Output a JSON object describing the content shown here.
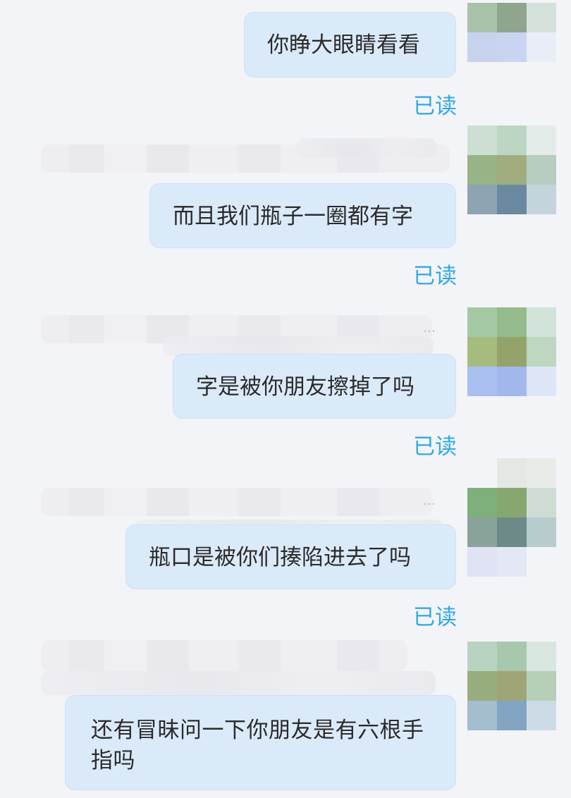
{
  "messages": [
    {
      "text": "你睁大眼睛看看",
      "status": "已读"
    },
    {
      "text": "而且我们瓶子一圈都有字",
      "status": "已读"
    },
    {
      "text": "字是被你朋友擦掉了吗",
      "status": "已读"
    },
    {
      "text": "瓶口是被你们揍陷进去了吗",
      "status": "已读"
    },
    {
      "text": "还有冒昧问一下你朋友是有六根手指吗"
    }
  ],
  "quote_ellipsis": "…",
  "colors": {
    "background": "#f3f4f8",
    "bubble": "#dbeaf9",
    "read_status": "#31a9e3",
    "text": "#2b2b2b"
  },
  "avatar_icon": "pixelated-profile-avatar"
}
